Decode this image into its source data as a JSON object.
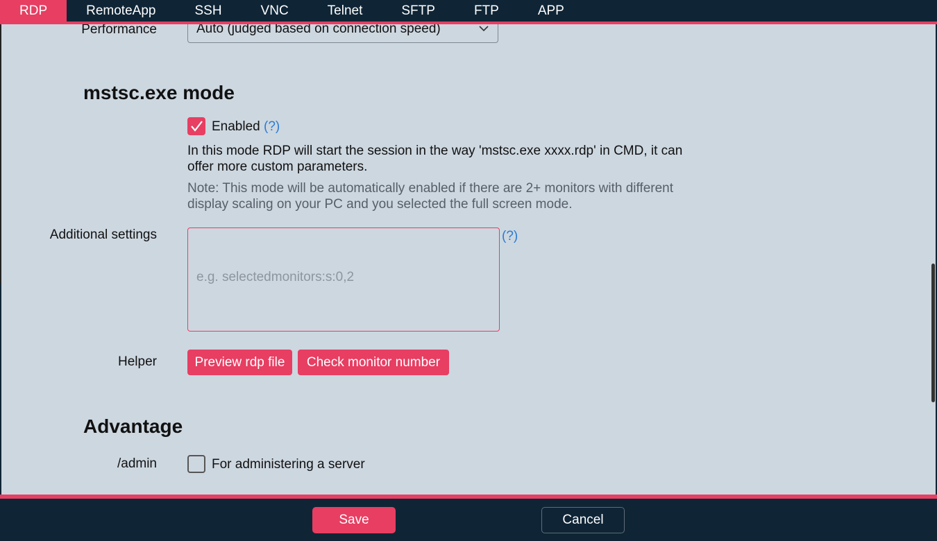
{
  "tabs": [
    "RDP",
    "RemoteApp",
    "SSH",
    "VNC",
    "Telnet",
    "SFTP",
    "FTP",
    "APP"
  ],
  "performance": {
    "label": "Performance",
    "value": "Auto (judged based on connection speed)"
  },
  "mstsc": {
    "heading": "mstsc.exe mode",
    "enabled_label": "Enabled",
    "help": "(?)",
    "description": "In this mode RDP will start the session in the way 'mstsc.exe xxxx.rdp' in CMD, it can offer more custom parameters.",
    "note": "Note: This mode will be automatically enabled if there are 2+ monitors with different display scaling on your PC and you selected the full screen mode."
  },
  "additional": {
    "label": "Additional settings",
    "placeholder": "e.g. selectedmonitors:s:0,2",
    "help": "(?)"
  },
  "helper": {
    "label": "Helper",
    "preview_btn": "Preview rdp file",
    "check_btn": "Check monitor number"
  },
  "advantage": {
    "heading": "Advantage",
    "admin_label": "/admin",
    "admin_text": "For administering a server"
  },
  "footer": {
    "save": "Save",
    "cancel": "Cancel"
  },
  "colors": {
    "accent": "#e73e62",
    "dark": "#0f2536",
    "panel": "#cdd7e0",
    "link": "#2a7bd3"
  }
}
